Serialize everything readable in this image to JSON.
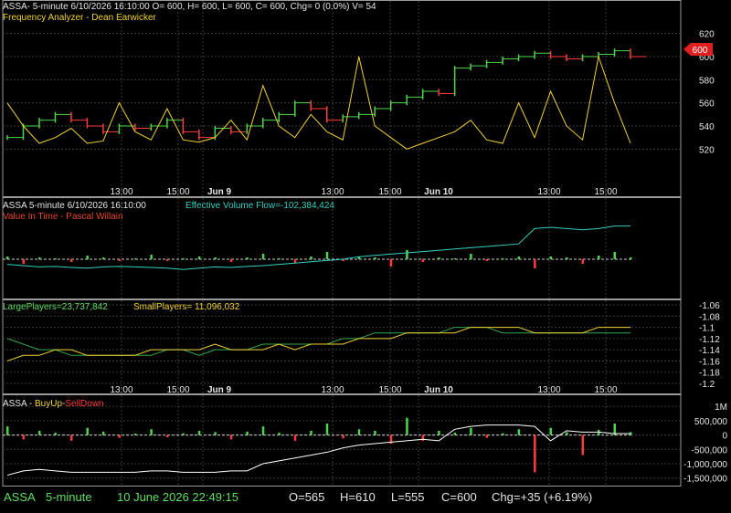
{
  "panels": {
    "price": {
      "header": "ASSA- 5-minute 6/10/2026 16:10:00 O= 600, H= 600, L= 600, C= 600, Chg= 0 (0.0%) V= 54",
      "indicator": "Frequency Analyzer - Dean Earwicker",
      "price_tag": "600"
    },
    "volume_flow": {
      "header": "ASSA 5-minute  6/10/2026 16:10:00",
      "indicator": "Effective Volume Flow=-102,384,424",
      "subheader": "Value In Time - Pascal Willain"
    },
    "players": {
      "large": "LargePlayers=23,737,842",
      "small": "SmallPlayers= 11,096,032"
    },
    "buyup": {
      "prefix": "ASSA - ",
      "buy": "BuyUp",
      "sep": "-",
      "sell": "SellDown"
    }
  },
  "status_bar": {
    "symbol": "ASSA",
    "interval": "5-minute",
    "datetime": "10 June 2026 22:49:15",
    "open": "O=565",
    "high": "H=610",
    "low": "L=555",
    "close": "C=600",
    "change": "Chg=+35 (+6.19%)"
  },
  "colors": {
    "background": "#000000",
    "up_bar": "#4cd64c",
    "down_bar": "#ff3b3b",
    "yellow_line": "#f2d230",
    "cyan_line": "#33d0c0",
    "green_line": "#2ea84a",
    "price_tag": "#e02020",
    "grid": "#3a3a3a",
    "status_green": "#3fcf3f"
  },
  "chart_data": [
    {
      "type": "line",
      "name": "price",
      "y_ticks": [
        "620",
        "600",
        "580",
        "560",
        "540",
        "520"
      ],
      "ylim": [
        510,
        630
      ],
      "x_ticks": [
        "13:00",
        "15:00",
        "Jun 9",
        "13:00",
        "15:00",
        "Jun 10",
        "13:00",
        "15:00"
      ],
      "close_series": [
        530,
        540,
        545,
        550,
        545,
        540,
        535,
        540,
        538,
        540,
        545,
        535,
        530,
        538,
        535,
        540,
        545,
        550,
        560,
        555,
        545,
        548,
        550,
        555,
        560,
        565,
        570,
        568,
        590,
        592,
        595,
        598,
        600,
        603,
        600,
        598,
        600,
        602,
        605,
        600
      ],
      "oscillator_series": [
        560,
        540,
        525,
        530,
        538,
        525,
        527,
        560,
        535,
        528,
        555,
        528,
        526,
        530,
        545,
        528,
        575,
        540,
        530,
        550,
        535,
        528,
        600,
        540,
        530,
        520,
        525,
        530,
        535,
        545,
        528,
        525,
        560,
        530,
        570,
        540,
        528,
        600,
        560,
        525
      ]
    },
    {
      "type": "bar",
      "name": "effective-volume-flow",
      "values": [
        0.3,
        -0.5,
        0.2,
        0.1,
        -0.3,
        0.4,
        0.2,
        -0.2,
        0.1,
        0.5,
        -0.2,
        0.1,
        0.3,
        0.2,
        -0.3,
        0.2,
        0.6,
        0.1,
        -0.4,
        0.3,
        0.8,
        -0.2,
        0.3,
        0.2,
        -0.8,
        1.0,
        -0.3,
        0.2,
        0.1,
        0.6,
        -0.2,
        0.1,
        0.3,
        -1.0,
        0.3,
        0.2,
        -0.5,
        0.4,
        0.8,
        0.2
      ],
      "flow_line": [
        -0.2,
        -0.25,
        -0.3,
        -0.28,
        -0.32,
        -0.35,
        -0.3,
        -0.28,
        -0.3,
        -0.32,
        -0.35,
        -0.4,
        -0.35,
        -0.3,
        -0.32,
        -0.28,
        -0.25,
        -0.2,
        -0.15,
        -0.1,
        -0.05,
        0.0,
        0.1,
        0.15,
        0.2,
        0.25,
        0.3,
        0.35,
        0.4,
        0.45,
        0.5,
        0.55,
        0.6,
        1.2,
        1.25,
        1.2,
        1.15,
        1.2,
        1.3,
        1.3
      ]
    },
    {
      "type": "line",
      "name": "players",
      "y_ticks": [
        "-1.06",
        "-1.08",
        "-1.1",
        "-1.12",
        "-1.14",
        "-1.16",
        "-1.18",
        "-1.2"
      ],
      "ylim": [
        -1.2,
        -1.06
      ],
      "series": [
        {
          "name": "LargePlayers",
          "values": [
            -1.12,
            -1.13,
            -1.14,
            -1.14,
            -1.15,
            -1.15,
            -1.15,
            -1.15,
            -1.15,
            -1.15,
            -1.14,
            -1.14,
            -1.15,
            -1.14,
            -1.14,
            -1.14,
            -1.13,
            -1.13,
            -1.13,
            -1.13,
            -1.13,
            -1.12,
            -1.12,
            -1.11,
            -1.11,
            -1.11,
            -1.11,
            -1.11,
            -1.1,
            -1.1,
            -1.1,
            -1.11,
            -1.11,
            -1.11,
            -1.11,
            -1.11,
            -1.11,
            -1.11,
            -1.11,
            -1.11
          ]
        },
        {
          "name": "SmallPlayers",
          "values": [
            -1.16,
            -1.15,
            -1.15,
            -1.14,
            -1.14,
            -1.15,
            -1.15,
            -1.15,
            -1.15,
            -1.14,
            -1.14,
            -1.14,
            -1.14,
            -1.13,
            -1.14,
            -1.14,
            -1.14,
            -1.13,
            -1.14,
            -1.13,
            -1.13,
            -1.13,
            -1.12,
            -1.12,
            -1.12,
            -1.11,
            -1.11,
            -1.11,
            -1.11,
            -1.1,
            -1.1,
            -1.1,
            -1.1,
            -1.11,
            -1.11,
            -1.11,
            -1.11,
            -1.1,
            -1.1,
            -1.1
          ]
        }
      ],
      "x_ticks": [
        "13:00",
        "15:00",
        "Jun 9",
        "13:00",
        "15:00",
        "Jun 10",
        "13:00",
        "15:00"
      ]
    },
    {
      "type": "bar",
      "name": "buyup-selldown",
      "y_ticks": [
        "1M",
        "500,000",
        "0",
        "-500,000",
        "-1,000,000",
        "-1,500,000"
      ],
      "ylim": [
        -1700000,
        1100000
      ],
      "values": [
        300000,
        -150000,
        150000,
        80000,
        -200000,
        250000,
        120000,
        -100000,
        50000,
        200000,
        -80000,
        60000,
        150000,
        100000,
        -150000,
        120000,
        300000,
        80000,
        -200000,
        150000,
        400000,
        -120000,
        200000,
        150000,
        -300000,
        600000,
        -200000,
        150000,
        80000,
        250000,
        -100000,
        60000,
        200000,
        -1300000,
        250000,
        100000,
        -700000,
        180000,
        400000,
        100000
      ],
      "cumulative_line": [
        -1400000,
        -1250000,
        -1200000,
        -1250000,
        -1300000,
        -1300000,
        -1300000,
        -1300000,
        -1300000,
        -1250000,
        -1250000,
        -1300000,
        -1300000,
        -1300000,
        -1250000,
        -1250000,
        -1000000,
        -900000,
        -800000,
        -700000,
        -600000,
        -450000,
        -350000,
        -300000,
        -250000,
        -200000,
        -150000,
        -200000,
        200000,
        300000,
        350000,
        350000,
        350000,
        300000,
        -200000,
        150000,
        100000,
        100000,
        50000,
        50000
      ]
    }
  ]
}
